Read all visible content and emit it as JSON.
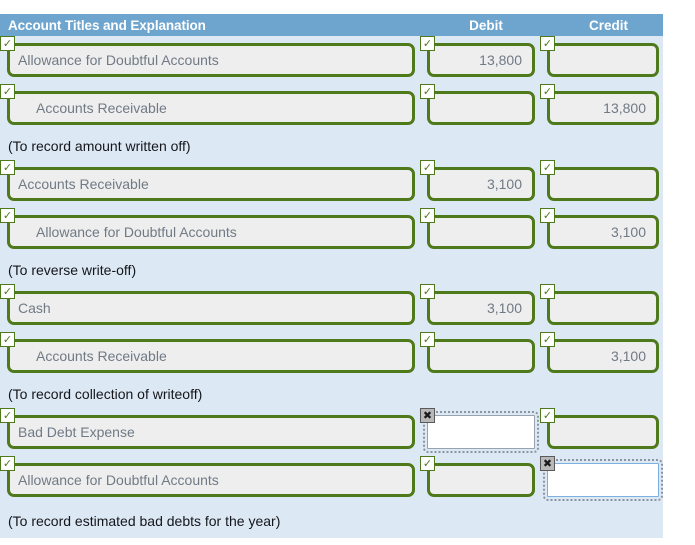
{
  "table": {
    "headers": {
      "account": "Account Titles and Explanation",
      "debit": "Debit",
      "credit": "Credit"
    },
    "colors": {
      "header_bg": "#6ea5ce",
      "header_text": "#ffffff",
      "row_bg": "#dde8f5",
      "correct_border": "#4f7a1c",
      "field_bg": "#eeeeee",
      "field_text": "#707a85",
      "focus_border": "#7fb0dd",
      "bad_badge_bg": "#b8b8b8"
    },
    "badges": {
      "correct": "✓",
      "incorrect": "✖",
      "correct_name": "check-icon",
      "incorrect_name": "x-mark-icon"
    },
    "entries": [
      {
        "lines": [
          {
            "account": "Allowance for Doubtful Accounts",
            "indent": false,
            "debit": "13,800",
            "credit": "",
            "account_status": "correct",
            "debit_status": "correct",
            "credit_status": "correct",
            "debit_empty": false,
            "credit_empty": true
          },
          {
            "account": "Accounts Receivable",
            "indent": true,
            "debit": "",
            "credit": "13,800",
            "account_status": "correct",
            "debit_status": "correct",
            "credit_status": "correct",
            "debit_empty": true,
            "credit_empty": false
          }
        ],
        "explanation": "(To record amount written off)"
      },
      {
        "lines": [
          {
            "account": "Accounts Receivable",
            "indent": false,
            "debit": "3,100",
            "credit": "",
            "account_status": "correct",
            "debit_status": "correct",
            "credit_status": "correct",
            "debit_empty": false,
            "credit_empty": true
          },
          {
            "account": "Allowance for Doubtful Accounts",
            "indent": true,
            "debit": "",
            "credit": "3,100",
            "account_status": "correct",
            "debit_status": "correct",
            "credit_status": "correct",
            "debit_empty": true,
            "credit_empty": false
          }
        ],
        "explanation": "(To reverse write-off)"
      },
      {
        "lines": [
          {
            "account": "Cash",
            "indent": false,
            "debit": "3,100",
            "credit": "",
            "account_status": "correct",
            "debit_status": "correct",
            "credit_status": "correct",
            "debit_empty": false,
            "credit_empty": true
          },
          {
            "account": "Accounts Receivable",
            "indent": true,
            "debit": "",
            "credit": "3,100",
            "account_status": "correct",
            "debit_status": "correct",
            "credit_status": "correct",
            "debit_empty": true,
            "credit_empty": false
          }
        ],
        "explanation": "(To record collection of writeoff)"
      },
      {
        "lines": [
          {
            "account": "Bad Debt Expense",
            "indent": false,
            "debit": "",
            "credit": "",
            "account_status": "correct",
            "debit_status": "incorrect",
            "credit_status": "correct",
            "debit_empty": true,
            "credit_empty": true,
            "debit_focused": false
          },
          {
            "account": "Allowance for Doubtful Accounts",
            "indent": false,
            "debit": "",
            "credit": "",
            "account_status": "correct",
            "debit_status": "correct",
            "credit_status": "incorrect",
            "debit_empty": true,
            "credit_empty": true,
            "credit_focused": true
          }
        ],
        "explanation": "(To record estimated bad debts for the year)"
      }
    ]
  }
}
